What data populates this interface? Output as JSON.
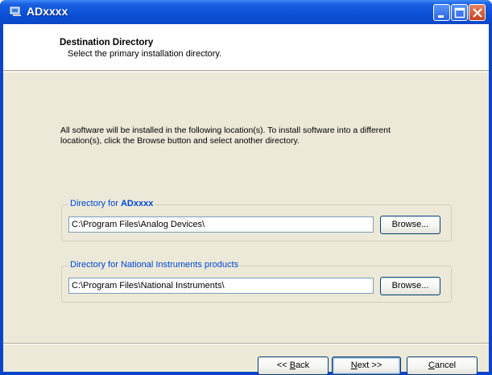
{
  "window": {
    "title": "ADxxxx"
  },
  "header": {
    "title": "Destination Directory",
    "subtitle": "Select the primary installation directory."
  },
  "intro": {
    "text": "All software will be installed in the following location(s). To install software into a different location(s), click the Browse button and select another directory."
  },
  "groups": [
    {
      "label_prefix": "Directory for ",
      "label_bold": "ADxxxx",
      "path": "C:\\Program Files\\Analog Devices\\",
      "browse_label": "Browse..."
    },
    {
      "label_prefix": "Directory for National Instruments products",
      "label_bold": "",
      "path": "C:\\Program Files\\National Instruments\\",
      "browse_label": "Browse..."
    }
  ],
  "footer": {
    "back_prefix": "<< ",
    "back_access": "B",
    "back_rest": "ack",
    "next_access": "N",
    "next_rest": "ext >>",
    "cancel_access": "C",
    "cancel_rest": "ancel"
  },
  "colors": {
    "titlebar": "#0b4fd6",
    "client_bg": "#ece9d8",
    "group_label": "#0046d5"
  },
  "icons": [
    "installer-icon",
    "minimize-icon",
    "maximize-icon",
    "close-icon"
  ]
}
